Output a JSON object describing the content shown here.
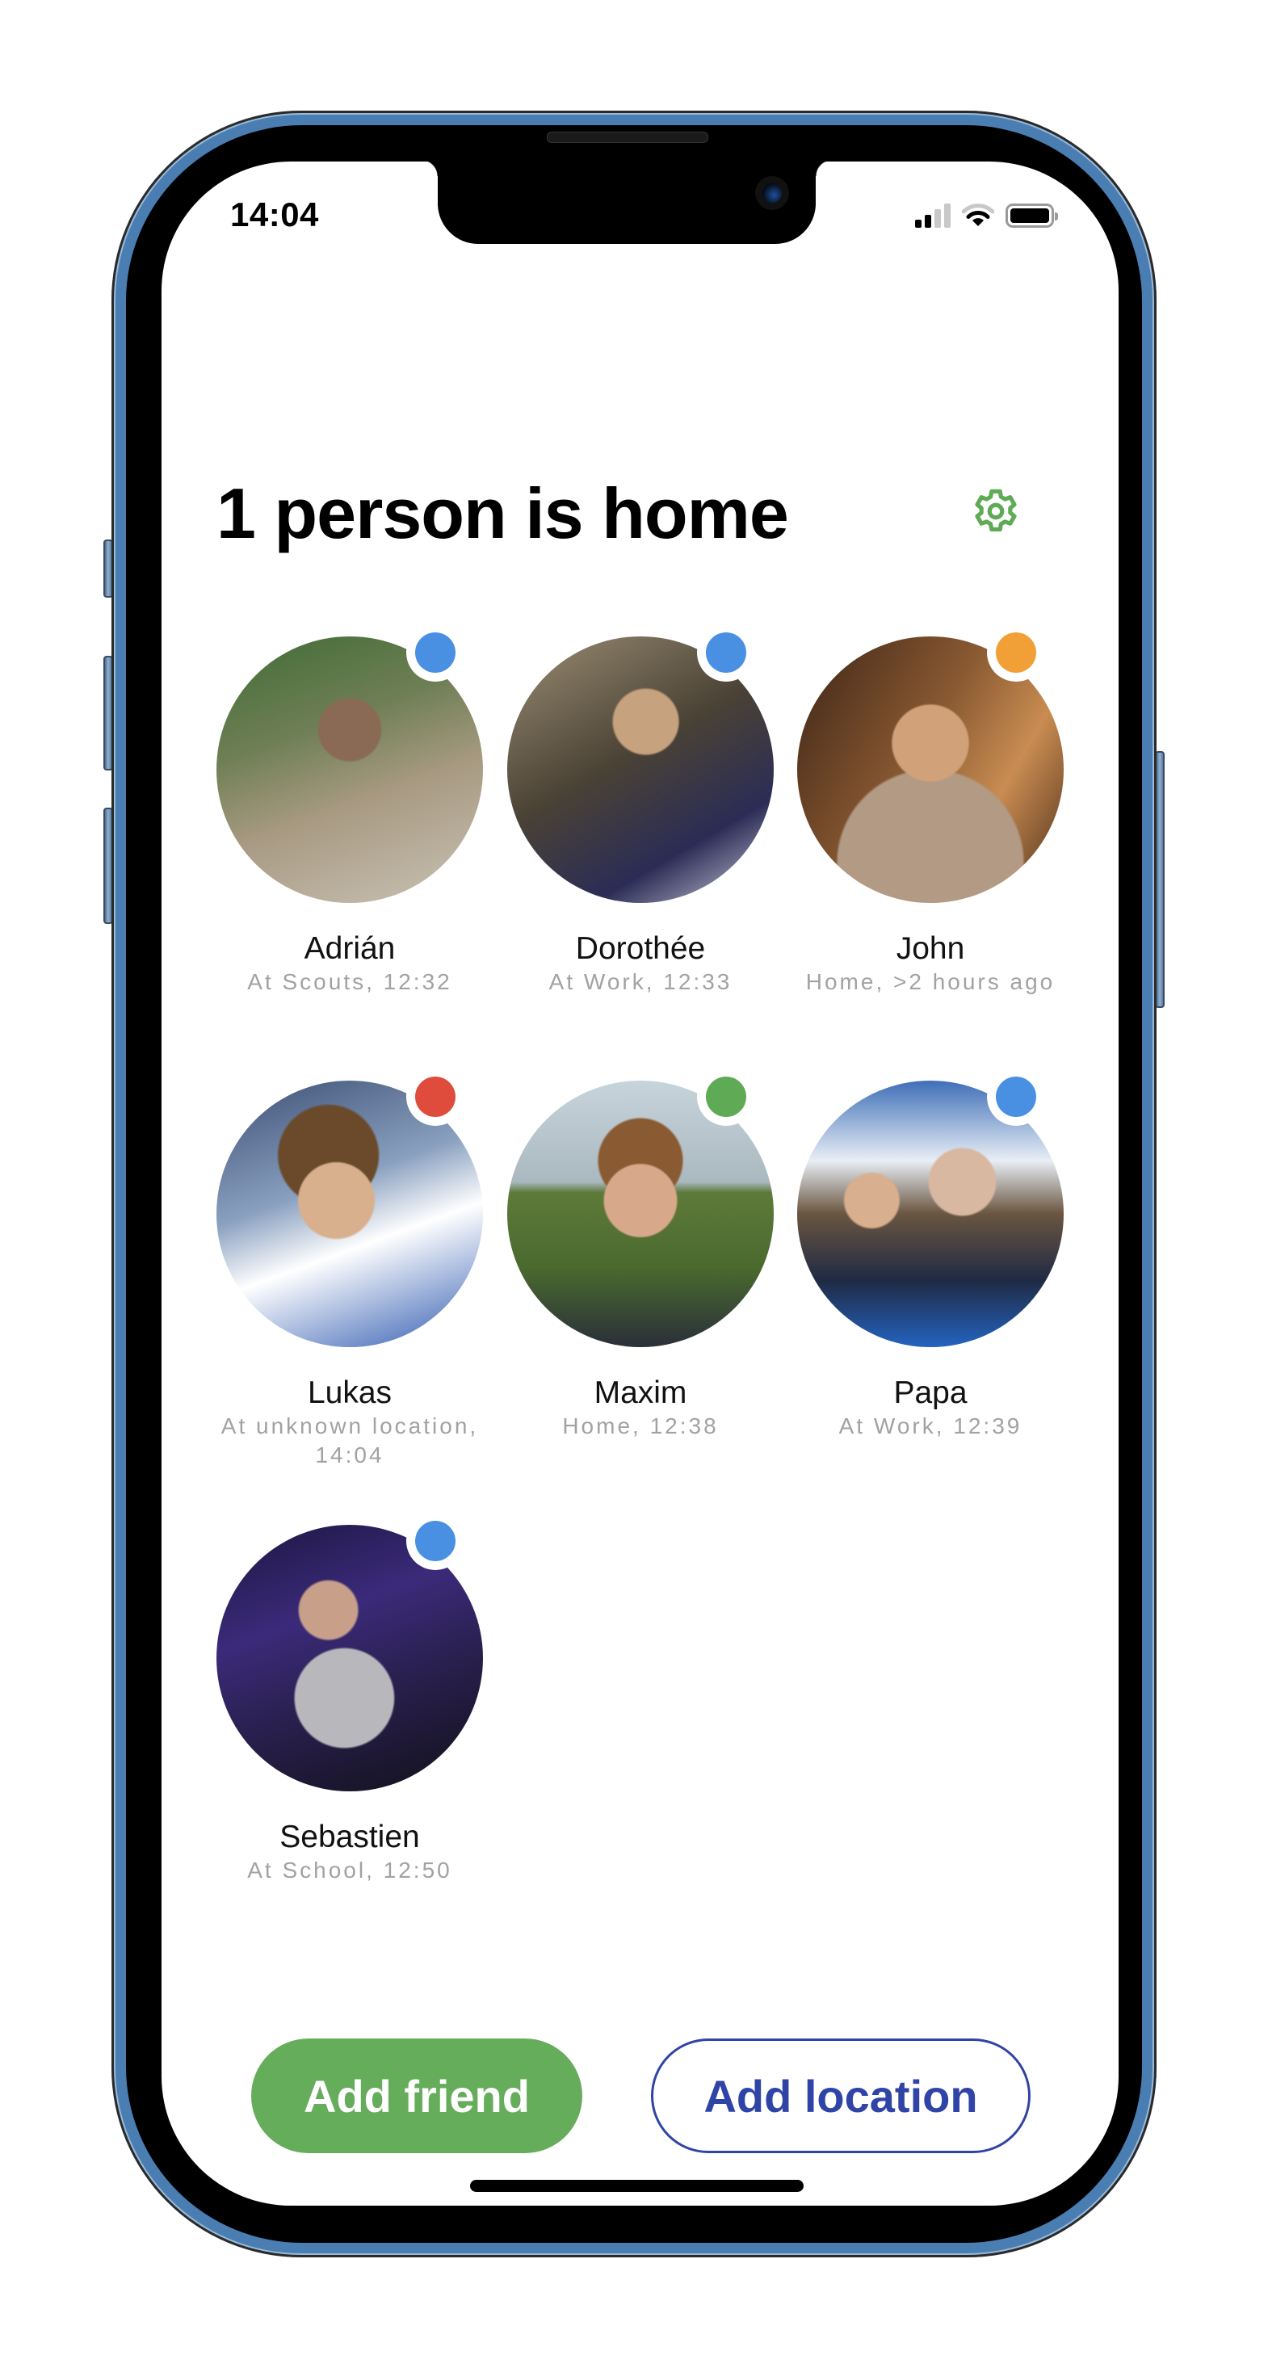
{
  "status_bar": {
    "time": "14:04",
    "signal_bars_filled": 2,
    "signal_bars_total": 4,
    "wifi_arcs_filled": 2,
    "wifi_arcs_total": 3,
    "battery_level": 1.0
  },
  "header": {
    "title": "1 person is home",
    "settings_icon": "gear-icon"
  },
  "colors": {
    "accent_green": "#66ad5b",
    "accent_blue": "#2f44a6",
    "status_blue": "#4a90e2",
    "status_orange": "#f0a037",
    "status_red": "#e04c3c",
    "status_green": "#5faa55",
    "subtitle_gray": "#a2a2a2"
  },
  "friends": [
    {
      "name": "Adrián",
      "status": "At Scouts, 12:32",
      "status_color": "#4a90e2"
    },
    {
      "name": "Dorothée",
      "status": "At Work, 12:33",
      "status_color": "#4a90e2"
    },
    {
      "name": "John",
      "status": "Home, >2 hours ago",
      "status_color": "#f0a037"
    },
    {
      "name": "Lukas",
      "status": "At unknown location, 14:04",
      "status_color": "#e04c3c"
    },
    {
      "name": "Maxim",
      "status": "Home, 12:38",
      "status_color": "#5faa55"
    },
    {
      "name": "Papa",
      "status": "At Work, 12:39",
      "status_color": "#4a90e2"
    },
    {
      "name": "Sebastien",
      "status": "At School, 12:50",
      "status_color": "#4a90e2"
    }
  ],
  "actions": {
    "add_friend_label": "Add friend",
    "add_location_label": "Add location"
  }
}
